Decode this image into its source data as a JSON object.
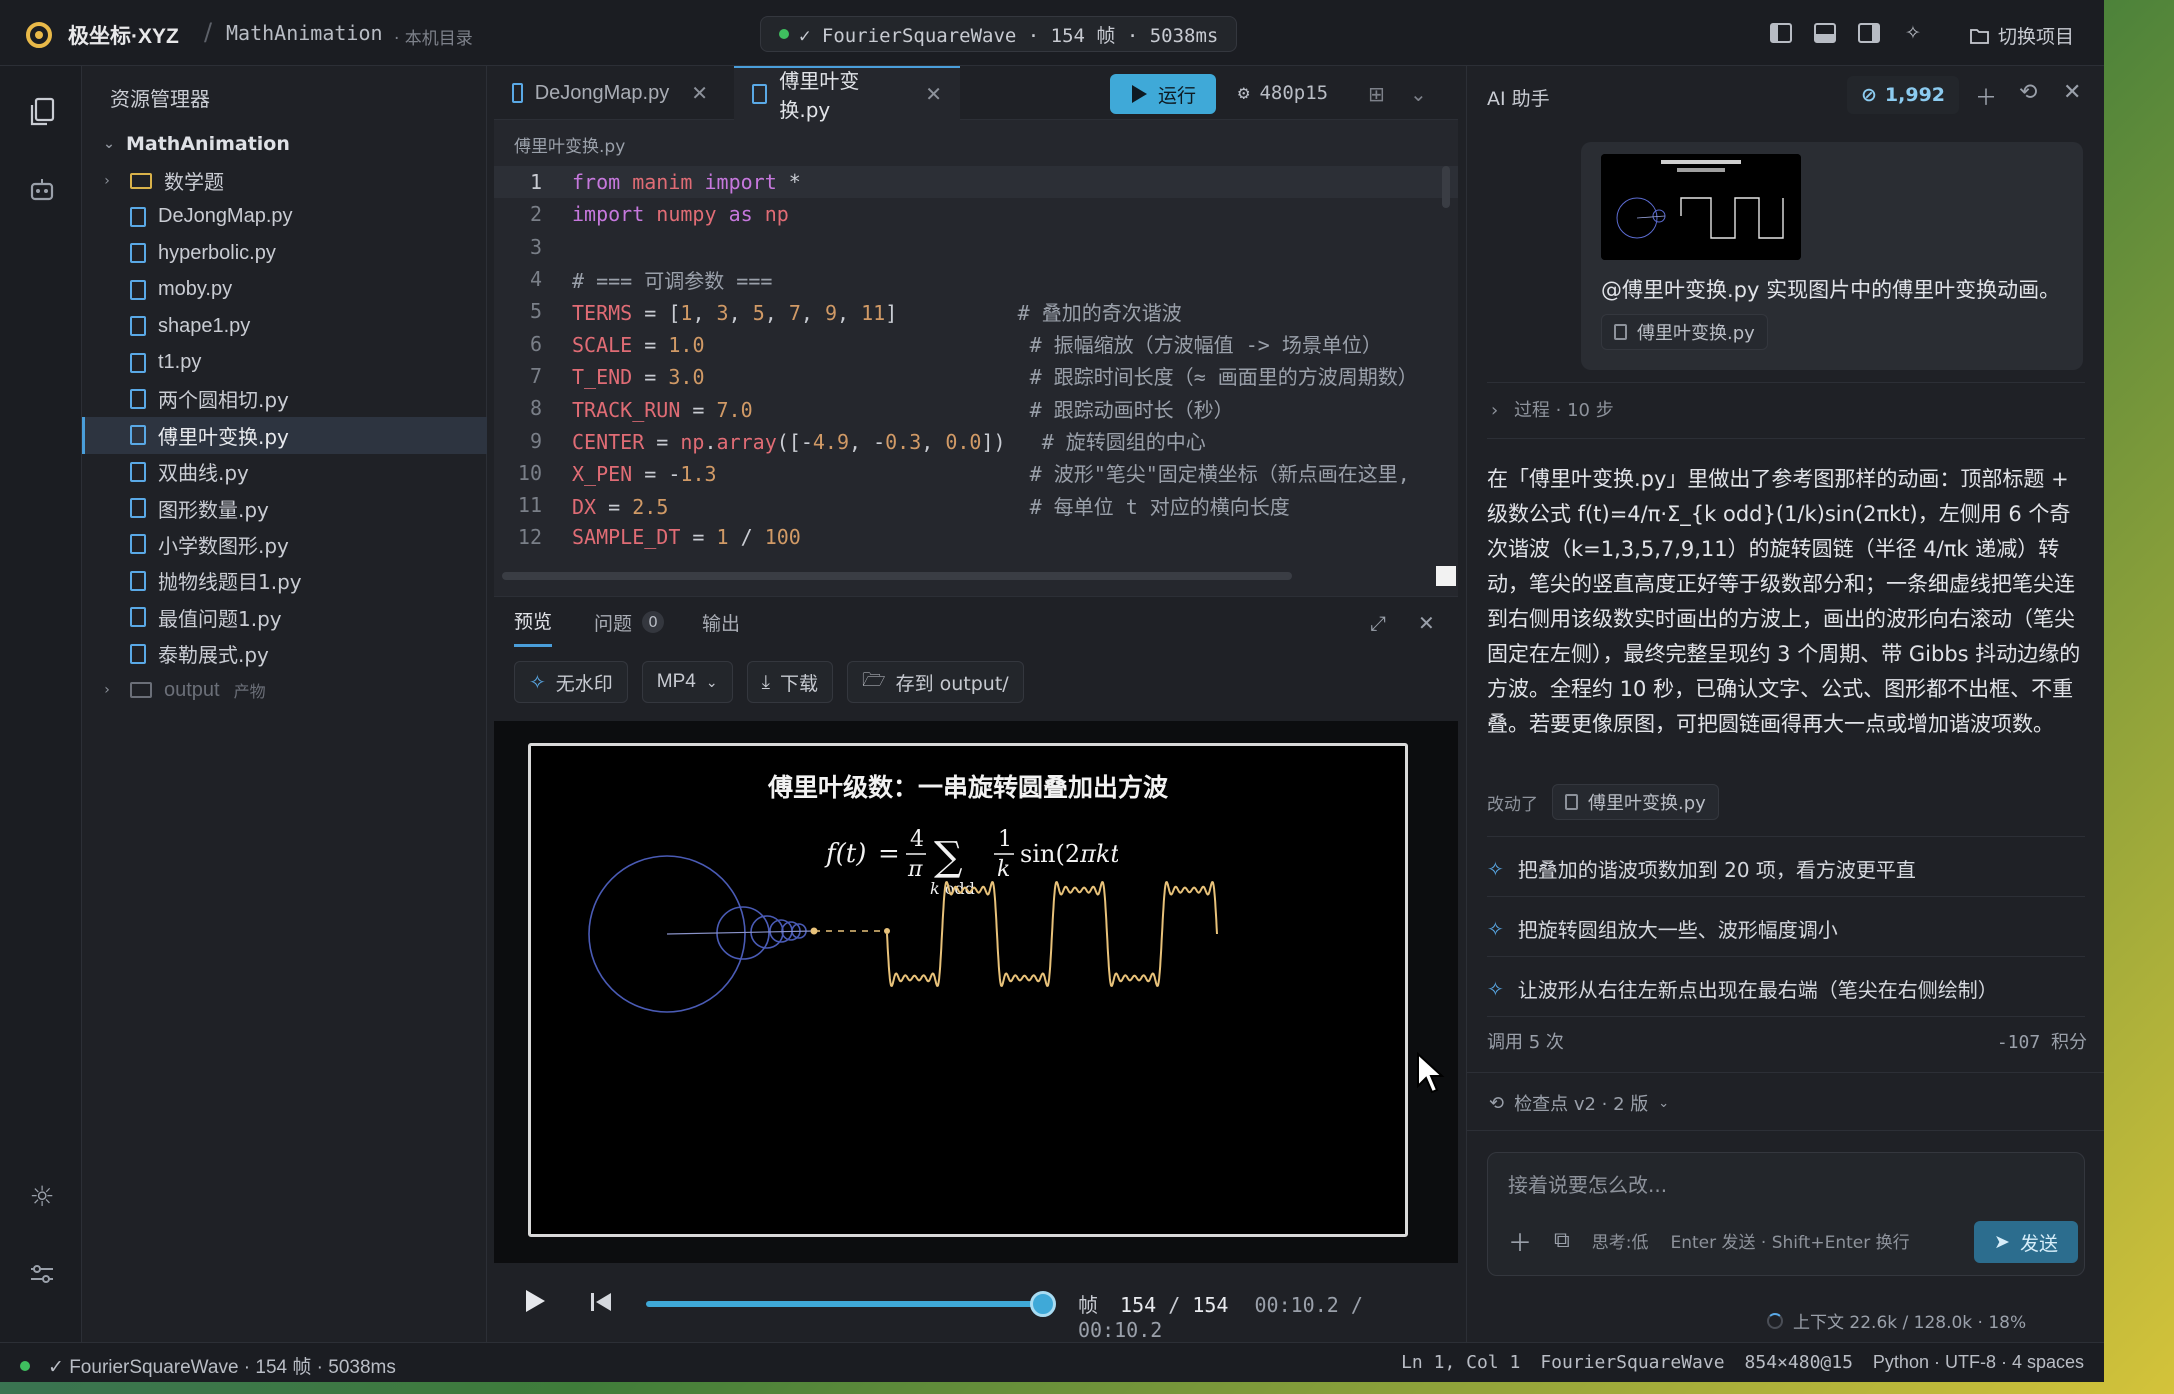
{
  "topbar": {
    "app_name": "极坐标·XYZ",
    "separator": "/",
    "project": "MathAnimation",
    "project_note": "· 本机目录",
    "run_status": "✓ FourierSquareWave · 154 帧 · 5038ms",
    "switch_project": "切换项目"
  },
  "explorer": {
    "title": "资源管理器",
    "root": "MathAnimation",
    "items": [
      {
        "type": "folder",
        "name": "数学题",
        "note": ""
      },
      {
        "type": "file",
        "name": "DeJongMap.py"
      },
      {
        "type": "file",
        "name": "hyperbolic.py"
      },
      {
        "type": "file",
        "name": "moby.py"
      },
      {
        "type": "file",
        "name": "shape1.py"
      },
      {
        "type": "file",
        "name": "t1.py"
      },
      {
        "type": "file",
        "name": "两个圆相切.py"
      },
      {
        "type": "file",
        "name": "傅里叶变换.py",
        "selected": true
      },
      {
        "type": "file",
        "name": "双曲线.py"
      },
      {
        "type": "file",
        "name": "图形数量.py"
      },
      {
        "type": "file",
        "name": "小学数图形.py"
      },
      {
        "type": "file",
        "name": "抛物线题目1.py"
      },
      {
        "type": "file",
        "name": "最值问题1.py"
      },
      {
        "type": "file",
        "name": "泰勒展式.py"
      },
      {
        "type": "folder",
        "name": "output",
        "note": "产物"
      }
    ]
  },
  "editor": {
    "tabs": [
      {
        "label": "DeJongMap.py",
        "close": "✕"
      },
      {
        "label": "傅里叶变换.py",
        "close": "✕"
      }
    ],
    "run_label": "运行",
    "quality": "480p15",
    "path": "傅里叶变换.py",
    "line_numbers": [
      "1",
      "2",
      "3",
      "4",
      "5",
      "6",
      "7",
      "8",
      "9",
      "10",
      "11",
      "12"
    ]
  },
  "preview": {
    "tabs": {
      "preview": "预览",
      "problems": "问题",
      "problems_count": "0",
      "output": "输出"
    },
    "watermark": "无水印",
    "format": "MP4",
    "download": "下载",
    "save_to": "存到 output/",
    "stage_title": "傅里叶级数：一串旋转圆叠加出方波",
    "frame_label": "帧",
    "frame_current": "154",
    "frame_sep": "/",
    "frame_total": "154",
    "time_current": "00:10.2",
    "time_sep": "/",
    "time_total": "00:10.2",
    "progress": 1.0
  },
  "ai": {
    "title": "AI 助手",
    "credits": "1,992",
    "user_message": "@傅里叶变换.py 实现图片中的傅里叶变换动画。",
    "user_file": "傅里叶变换.py",
    "process": "过程 · 10 步",
    "answer": "在「傅里叶变换.py」里做出了参考图那样的动画：顶部标题 + 级数公式 f(t)=4/π·Σ_{k odd}(1/k)sin(2πkt)，左侧用 6 个奇次谐波（k=1,3,5,7,9,11）的旋转圆链（半径 4/πk 递减）转动，笔尖的竖直高度正好等于级数部分和；一条细虚线把笔尖连到右侧用该级数实时画出的方波上，画出的波形向右滚动（笔尖固定在左侧），最终完整呈现约 3 个周期、带 Gibbs 抖动边缘的方波。全程约 10 秒，已确认文字、公式、图形都不出框、不重叠。若要更像原图，可把圆链画得再大一点或增加谐波项数。",
    "changed_label": "改动了",
    "changed_file": "傅里叶变换.py",
    "suggestions": [
      "把叠加的谐波项数加到 20 项，看方波更平直",
      "把旋转圆组放大一些、波形幅度调小",
      "让波形从右往左新点出现在最右端（笔尖在右侧绘制）"
    ],
    "calls": "调用 5 次",
    "points": "-107 积分",
    "checkpoint": "检查点 v2 · 2 版",
    "composer_placeholder": "接着说要怎么改...",
    "thinking": "思考:低",
    "hint": "Enter 发送 · Shift+Enter 换行",
    "send": "发送",
    "context": "上下文 22.6k / 128.0k · 18%"
  },
  "statusbar": {
    "left": "✓ FourierSquareWave · 154 帧 · 5038ms",
    "position": "Ln 1, Col 1",
    "scene": "FourierSquareWave",
    "resolution": "854×480@15",
    "language": "Python · UTF-8 · 4 spaces"
  },
  "colors": {
    "accent": "#3fa9d8",
    "wave": "#e8c27a",
    "circles": "#4a5bb5",
    "folder": "#d9b24a",
    "file": "#5aa9e6"
  }
}
